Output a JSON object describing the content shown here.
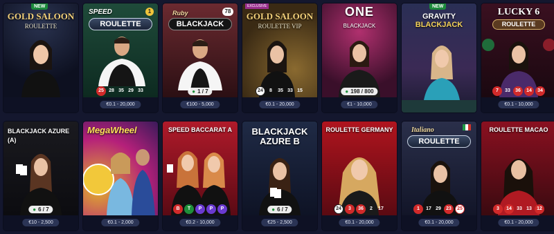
{
  "tiles": [
    {
      "id": "gold-saloon-roulette",
      "title": "GOLD SALOON",
      "subtitle": "ROULETTE",
      "badge": "NEW",
      "limit": "",
      "results": []
    },
    {
      "id": "speed-roulette",
      "title": "SPEED",
      "subtitle": "ROULETTE",
      "badge_num": "1",
      "limit": "€0.1 - 20,000",
      "results": [
        {
          "v": "25",
          "c": "red"
        },
        {
          "v": "28",
          "c": "black"
        },
        {
          "v": "35",
          "c": "black"
        },
        {
          "v": "29",
          "c": "black"
        },
        {
          "v": "33",
          "c": "black"
        }
      ]
    },
    {
      "id": "ruby-blackjack",
      "title": "Ruby",
      "subtitle": "BLACKJACK",
      "badge_num": "78",
      "limit": "€100 - 5,000",
      "seats": "1 / 7"
    },
    {
      "id": "gold-saloon-roulette-vip",
      "title": "GOLD SALOON",
      "subtitle": "ROULETTE VIP",
      "exclusive": "EXCLUSIVE",
      "limit": "€0.1 - 20,000",
      "results": [
        {
          "v": "24",
          "c": "ringb"
        },
        {
          "v": "8",
          "c": "black"
        },
        {
          "v": "35",
          "c": "black"
        },
        {
          "v": "33",
          "c": "black"
        },
        {
          "v": "15",
          "c": "black"
        }
      ]
    },
    {
      "id": "one-blackjack",
      "title": "ONE",
      "subtitle": "BLACKJACK",
      "limit": "€1 - 10,000",
      "seats": "198 / 800"
    },
    {
      "id": "gravity-blackjack",
      "title": "GRAVITY",
      "subtitle": "BLACKJACK",
      "badge": "NEW",
      "limit": "",
      "results": []
    },
    {
      "id": "lucky-6-roulette",
      "title": "LUCKY 6",
      "subtitle": "ROULETTE",
      "limit": "€0.1 - 10,000",
      "results": [
        {
          "v": "7",
          "c": "red"
        },
        {
          "v": "33",
          "c": "black"
        },
        {
          "v": "36",
          "c": "red"
        },
        {
          "v": "14",
          "c": "red"
        },
        {
          "v": "34",
          "c": "red"
        }
      ]
    },
    {
      "id": "blackjack-azure-a",
      "title": "BLACKJACK AZURE (A)",
      "limit": "€10 - 2,500",
      "seats": "6 / 7"
    },
    {
      "id": "mega-wheel",
      "title": "MegaWheel",
      "limit": "€0.1 - 2,000"
    },
    {
      "id": "speed-baccarat-a",
      "title": "SPEED BACCARAT A",
      "limit": "€0.2 - 10,000",
      "results": [
        {
          "v": "B",
          "c": "red"
        },
        {
          "v": "T",
          "c": "green"
        },
        {
          "v": "P",
          "c": "purple"
        },
        {
          "v": "P",
          "c": "purple"
        },
        {
          "v": "P",
          "c": "purple"
        }
      ]
    },
    {
      "id": "blackjack-azure-b",
      "title": "BLACKJACK",
      "subtitle": "AZURE B",
      "limit": "€25 - 2,500",
      "seats": "6 / 7"
    },
    {
      "id": "roulette-germany",
      "title": "ROULETTE GERMANY",
      "limit": "€0.1 - 20,000",
      "results": [
        {
          "v": "24",
          "c": "ringb"
        },
        {
          "v": "3",
          "c": "red"
        },
        {
          "v": "36",
          "c": "red"
        },
        {
          "v": "2",
          "c": "black"
        },
        {
          "v": "17",
          "c": "black"
        }
      ]
    },
    {
      "id": "italiano-roulette",
      "title": "Italiano",
      "subtitle": "ROULETTE",
      "limit": "€0.1 - 20,000",
      "results": [
        {
          "v": "1",
          "c": "red"
        },
        {
          "v": "17",
          "c": "black"
        },
        {
          "v": "29",
          "c": "black"
        },
        {
          "v": "23",
          "c": "red"
        },
        {
          "v": "25",
          "c": "ring"
        }
      ]
    },
    {
      "id": "roulette-macao",
      "title": "ROULETTE MACAO",
      "limit": "€0.1 - 20,000",
      "results": [
        {
          "v": "3",
          "c": "red"
        },
        {
          "v": "14",
          "c": "red"
        },
        {
          "v": "33",
          "c": "black"
        },
        {
          "v": "13",
          "c": "black"
        },
        {
          "v": "12",
          "c": "red"
        }
      ]
    }
  ],
  "colors": {
    "background": "#14172e",
    "limit_bar": "#0e1124",
    "limit_pill": "#2b3455",
    "red": "#d12a2a",
    "green": "#1f8f3a",
    "purple": "#6a3ad0"
  }
}
